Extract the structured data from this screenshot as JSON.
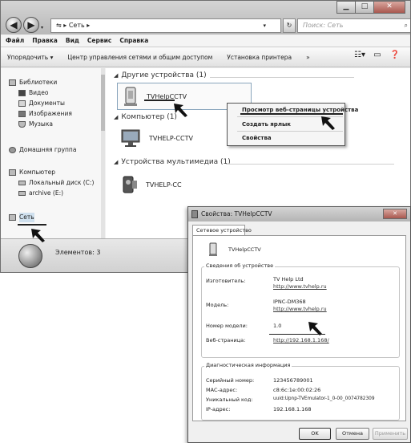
{
  "explorer": {
    "address": [
      "Сеть",
      "▸"
    ],
    "search_placeholder": "Поиск: Сеть",
    "menu": [
      "Файл",
      "Правка",
      "Вид",
      "Сервис",
      "Справка"
    ],
    "toolbar": [
      "Упорядочить ▾",
      "Центр управления сетями и общим доступом",
      "Установка принтера",
      "»"
    ],
    "nav": {
      "libraries": "Библиотеки",
      "videos": "Видео",
      "documents": "Документы",
      "pictures": "Изображения",
      "music": "Музыка",
      "homegroup": "Домашняя группа",
      "computer": "Компьютер",
      "local_disk": "Локальный диск (C:)",
      "archive": "archive (E:)",
      "network": "Сеть"
    },
    "groups": {
      "other": "Другие устройства (1)",
      "computer": "Компьютер (1)",
      "media": "Устройства мультимедиа (1)"
    },
    "devices": {
      "tvhelp": "TVHelpCCTV",
      "pc": "TVHELP-CCTV",
      "media": "TVHELP-CC"
    },
    "context_menu": [
      "Просмотр веб-страницы устройства",
      "Создать ярлык",
      "Свойства"
    ],
    "status": "Элементов: 3"
  },
  "properties": {
    "title": "Свойства: TVHelpCCTV",
    "tab": "Сетевое устройство",
    "device_name": "TVHelpCCTV",
    "info_group": "Сведения об устройстве",
    "fields": {
      "manufacturer_label": "Изготовитель:",
      "manufacturer": "TV Help Ltd",
      "manufacturer_url": "http://www.tvhelp.ru",
      "model_label": "Модель:",
      "model": "IPNC-DM368",
      "model_url": "http://www.tvhelp.ru",
      "model_no_label": "Номер модели:",
      "model_no": "1.0",
      "webpage_label": "Веб-страница:",
      "webpage": "http://192.168.1.168/"
    },
    "diag_group": "Диагностическая информация",
    "diag": {
      "serial_label": "Серийный номер:",
      "serial": "123456789001",
      "mac_label": "MAC-адрес:",
      "mac": "c8:6c:1e:00:02:26",
      "uid_label": "Уникальный код:",
      "uid": "uuid:Upnp-TVEmulator-1_0-00_0074782309",
      "ip_label": "IP-адрес:",
      "ip": "192.168.1.168"
    },
    "buttons": {
      "ok": "OK",
      "cancel": "Отмена",
      "apply": "Применить"
    }
  }
}
